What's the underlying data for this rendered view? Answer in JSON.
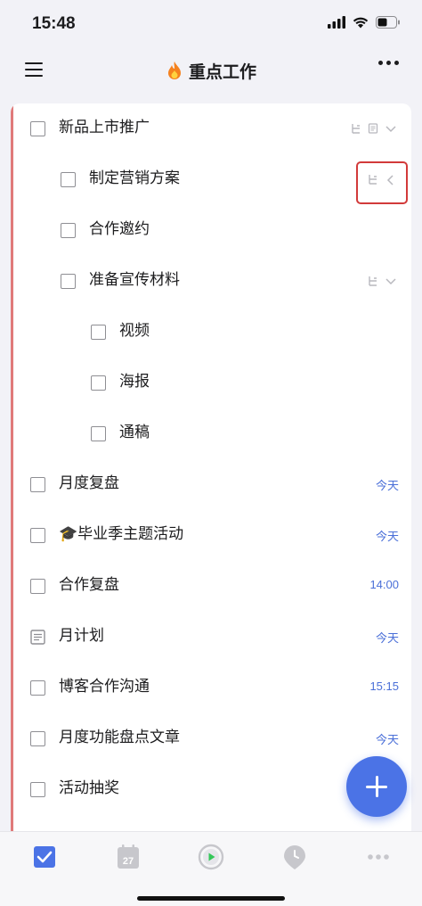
{
  "status_bar": {
    "time": "15:48"
  },
  "header": {
    "title": "重点工作",
    "title_icon": "fire-icon"
  },
  "tasks": [
    {
      "title": "新品上市推广",
      "level": 0,
      "type": "task",
      "actions": [
        "subtask-icon",
        "note-icon",
        "chevron-down-icon"
      ]
    },
    {
      "title": "制定营销方案",
      "level": 1,
      "type": "task",
      "actions": [
        "subtask-icon",
        "chevron-left-icon"
      ],
      "highlighted": true
    },
    {
      "title": "合作邀约",
      "level": 1,
      "type": "task"
    },
    {
      "title": "准备宣传材料",
      "level": 1,
      "type": "task",
      "actions": [
        "subtask-icon",
        "chevron-down-icon"
      ]
    },
    {
      "title": "视频",
      "level": 2,
      "type": "task"
    },
    {
      "title": "海报",
      "level": 2,
      "type": "task"
    },
    {
      "title": "通稿",
      "level": 2,
      "type": "task"
    },
    {
      "title": "月度复盘",
      "level": 0,
      "type": "task",
      "due": "今天"
    },
    {
      "title": "毕业季主题活动",
      "level": 0,
      "type": "task",
      "due": "今天",
      "emoji": "🎓"
    },
    {
      "title": "合作复盘",
      "level": 0,
      "type": "task",
      "due": "14:00"
    },
    {
      "title": "月计划",
      "level": 0,
      "type": "note",
      "due": "今天"
    },
    {
      "title": "博客合作沟通",
      "level": 0,
      "type": "task",
      "due": "15:15"
    },
    {
      "title": "月度功能盘点文章",
      "level": 0,
      "type": "task",
      "due": "今天"
    },
    {
      "title": "活动抽奖",
      "level": 0,
      "type": "task"
    }
  ],
  "tab_bar": {
    "tabs": [
      {
        "icon": "task-checkbox-icon",
        "active": true
      },
      {
        "icon": "calendar-icon",
        "label": "27"
      },
      {
        "icon": "pomodoro-play-icon"
      },
      {
        "icon": "habit-clock-icon"
      },
      {
        "icon": "more-dots-icon"
      }
    ]
  },
  "colors": {
    "accent": "#4b73e6",
    "due_text": "#4a6fd8",
    "list_bar": "#e07a7a",
    "highlight": "#d23a3a"
  }
}
